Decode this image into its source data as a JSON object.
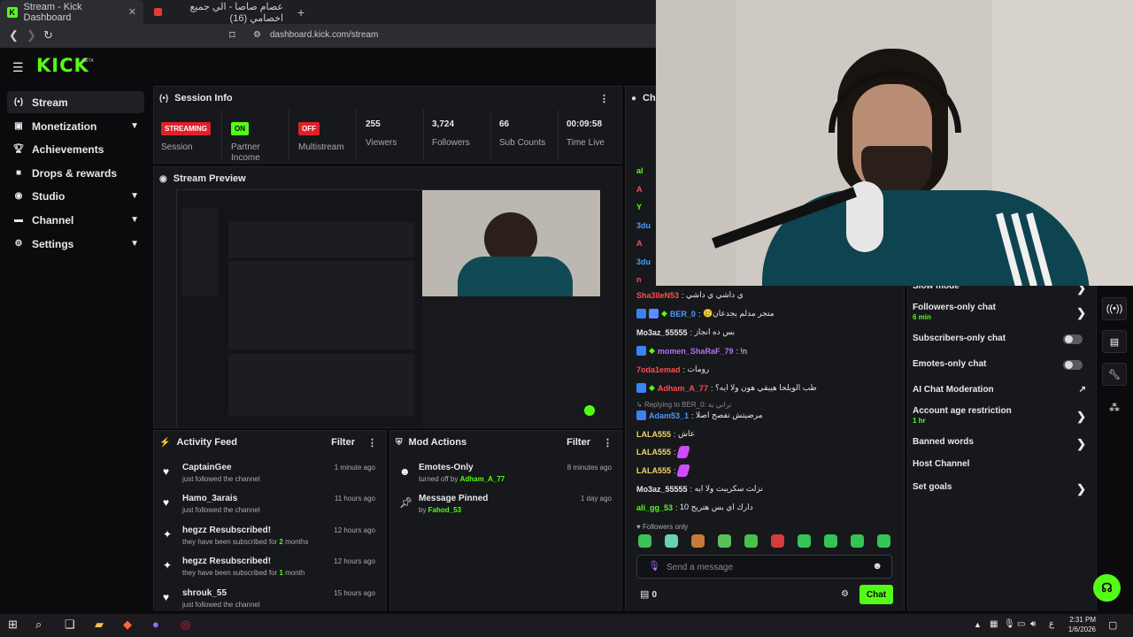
{
  "browser": {
    "tabs": [
      {
        "label": "Stream - Kick Dashboard"
      },
      {
        "label": "عصام صاصا - الي جميع اخصامي (16)"
      }
    ],
    "url": "dashboard.kick.com/stream"
  },
  "app": {
    "logo": "KICK",
    "beta": "BETA"
  },
  "sidebar": {
    "items": [
      {
        "label": "Stream",
        "icon": "broadcast-icon",
        "has_chevron": false
      },
      {
        "label": "Monetization",
        "icon": "dollar-icon",
        "has_chevron": true
      },
      {
        "label": "Achievements",
        "icon": "trophy-icon",
        "has_chevron": false
      },
      {
        "label": "Drops & rewards",
        "icon": "gift-icon",
        "has_chevron": false
      },
      {
        "label": "Studio",
        "icon": "studio-icon",
        "has_chevron": true
      },
      {
        "label": "Channel",
        "icon": "channel-icon",
        "has_chevron": true
      },
      {
        "label": "Settings",
        "icon": "gear-icon",
        "has_chevron": true
      }
    ]
  },
  "session_info": {
    "title": "Session Info",
    "stats": [
      {
        "badge": "STREAMING",
        "label": "Session",
        "badge_color": "#e0202a"
      },
      {
        "badge": "ON",
        "label": "Partner Income",
        "badge_color": "#53fc18"
      },
      {
        "badge": "OFF",
        "label": "Multistream",
        "badge_color": "#e0202a"
      },
      {
        "value": "255",
        "label": "Viewers"
      },
      {
        "value": "3,724",
        "label": "Followers"
      },
      {
        "value": "66",
        "label": "Sub Counts"
      },
      {
        "value": "00:09:58",
        "label": "Time Live"
      }
    ]
  },
  "stream_preview": {
    "title": "Stream Preview"
  },
  "activity_feed": {
    "title": "Activity Feed",
    "filter": "Filter",
    "items": [
      {
        "icon": "heart-icon",
        "name": "CaptainGee",
        "sub": "just followed the channel",
        "time": "1 minute ago"
      },
      {
        "icon": "heart-icon",
        "name": "Hamo_3arais",
        "sub": "just followed the channel",
        "time": "11 hours ago"
      },
      {
        "icon": "star-icon",
        "name": "hegzz Resubscribed!",
        "sub_pre": "they have been subscribed for ",
        "sub_num": "2",
        "sub_post": " months",
        "time": "12 hours ago"
      },
      {
        "icon": "star-icon",
        "name": "hegzz Resubscribed!",
        "sub_pre": "they have been subscribed for ",
        "sub_num": "1",
        "sub_post": " month",
        "time": "12 hours ago"
      },
      {
        "icon": "heart-icon",
        "name": "shrouk_55",
        "sub": "just followed the channel",
        "time": "15 hours ago"
      }
    ]
  },
  "mod_actions": {
    "title": "Mod Actions",
    "filter": "Filter",
    "items": [
      {
        "icon": "smiley-icon",
        "name": "Emotes-Only",
        "sub_pre": "turned off by ",
        "user": "Adham_A_77",
        "time": "8 minutes ago"
      },
      {
        "icon": "pin-icon",
        "name": "Message Pinned",
        "sub_pre": "by ",
        "user": "Fahod_53",
        "time": "1 day ago"
      }
    ]
  },
  "chat": {
    "title": "Cha",
    "lines": [
      {
        "user": "Sha3lleN53",
        "color": "#ff4d4d",
        "text": "ي داشي ي داشي",
        "badges": 0
      },
      {
        "user": "BER_0",
        "color": "#4a9bff",
        "text": "🥲متجر مدلم يجدعان",
        "badges": 3
      },
      {
        "user": "Mo3az_55555",
        "color": "#e8e8ea",
        "text": "بس ده انجاز",
        "badges": 0
      },
      {
        "user": "momen_ShaRaF_79",
        "color": "#b86bff",
        "text": "!n",
        "badges": 2
      },
      {
        "user": "7oda1emad",
        "color": "#ff4d4d",
        "text": "رومات",
        "badges": 0
      },
      {
        "user": "Adham_A_77",
        "color": "#ff4d4d",
        "text": "طب الوبلحا هيبقي هون ولا ايه؟",
        "badges": 2
      },
      {
        "user": "Adam53_1",
        "color": "#4a9bff",
        "text": "مرضيتش تفصح اصلا",
        "badges": 1
      },
      {
        "user": "LALA555",
        "color": "#f2d46b",
        "text": "عاش",
        "badges": 0
      },
      {
        "user": "LALA555",
        "color": "#f2d46b",
        "text": "",
        "badges": 0
      },
      {
        "user": "LALA555",
        "color": "#f2d46b",
        "text": "",
        "badges": 0
      },
      {
        "user": "Mo3az_55555",
        "color": "#e8e8ea",
        "text": "نزلت سكريبت ولا ايه",
        "badges": 0
      },
      {
        "user": "ali_gg_53",
        "color": "#53fc18",
        "text": "دارك اي بس هتريح 10",
        "badges": 0
      }
    ],
    "reply_note": "Replying to BER_0: تراني بة",
    "left_names": [
      "al",
      "A",
      "Y",
      "3du",
      "A",
      "3du",
      "n"
    ],
    "followers_only": "Followers only",
    "message_placeholder": "Send a message",
    "points": "0",
    "chat_button": "Chat"
  },
  "chat_settings": {
    "items": [
      {
        "label": "Slow mode",
        "type": "arrow"
      },
      {
        "label": "Followers-only chat",
        "sub": "6 min",
        "type": "arrow"
      },
      {
        "label": "Subscribers-only chat",
        "type": "toggle"
      },
      {
        "label": "Emotes-only chat",
        "type": "toggle"
      },
      {
        "label": "AI Chat Moderation",
        "type": "external"
      },
      {
        "label": "Account age restriction",
        "sub": "1 hr",
        "type": "arrow"
      },
      {
        "label": "Banned words",
        "type": "arrow"
      },
      {
        "label": "Host Channel",
        "type": "none"
      },
      {
        "label": "Set goals",
        "type": "arrow"
      }
    ]
  },
  "taskbar": {
    "time": "2:31 PM",
    "date": "1/6/2026",
    "lang": "ع"
  }
}
